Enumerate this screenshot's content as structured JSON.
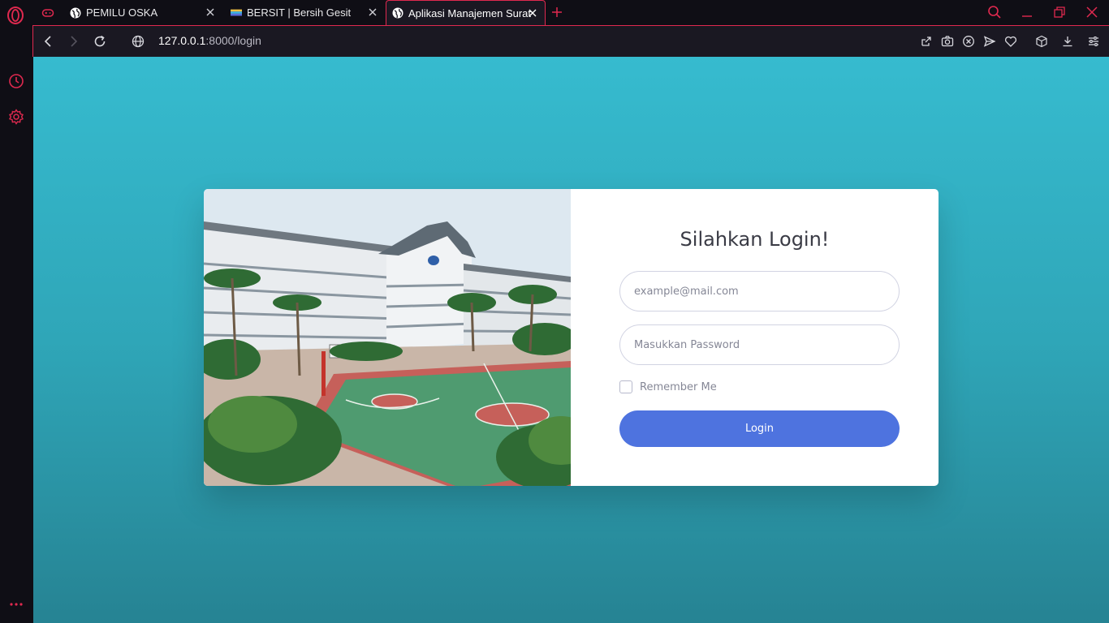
{
  "browser": {
    "tabs": [
      {
        "title": "PEMILU OSKA"
      },
      {
        "title": "BERSIT | Bersih Gesit"
      },
      {
        "title": "Aplikasi Manajemen Surat"
      }
    ],
    "url_host": "127.0.0.1",
    "url_rest": ":8000/login",
    "accent_color": "#e0294f"
  },
  "login": {
    "title": "Silahkan Login!",
    "email_placeholder": "example@mail.com",
    "password_placeholder": "Masukkan Password",
    "remember_label": "Remember Me",
    "button_label": "Login",
    "button_color": "#4e73df"
  },
  "icons": [
    "opera-logo-icon",
    "gamepad-icon",
    "globe-icon",
    "close-icon",
    "plus-icon",
    "search-icon",
    "minimize-icon",
    "restore-icon",
    "back-icon",
    "forward-icon",
    "reload-icon",
    "share-icon",
    "camera-icon",
    "block-icon",
    "send-icon",
    "heart-icon",
    "cube-icon",
    "download-icon",
    "settings-sliders-icon",
    "clock-icon",
    "gear-icon",
    "more-icon"
  ]
}
